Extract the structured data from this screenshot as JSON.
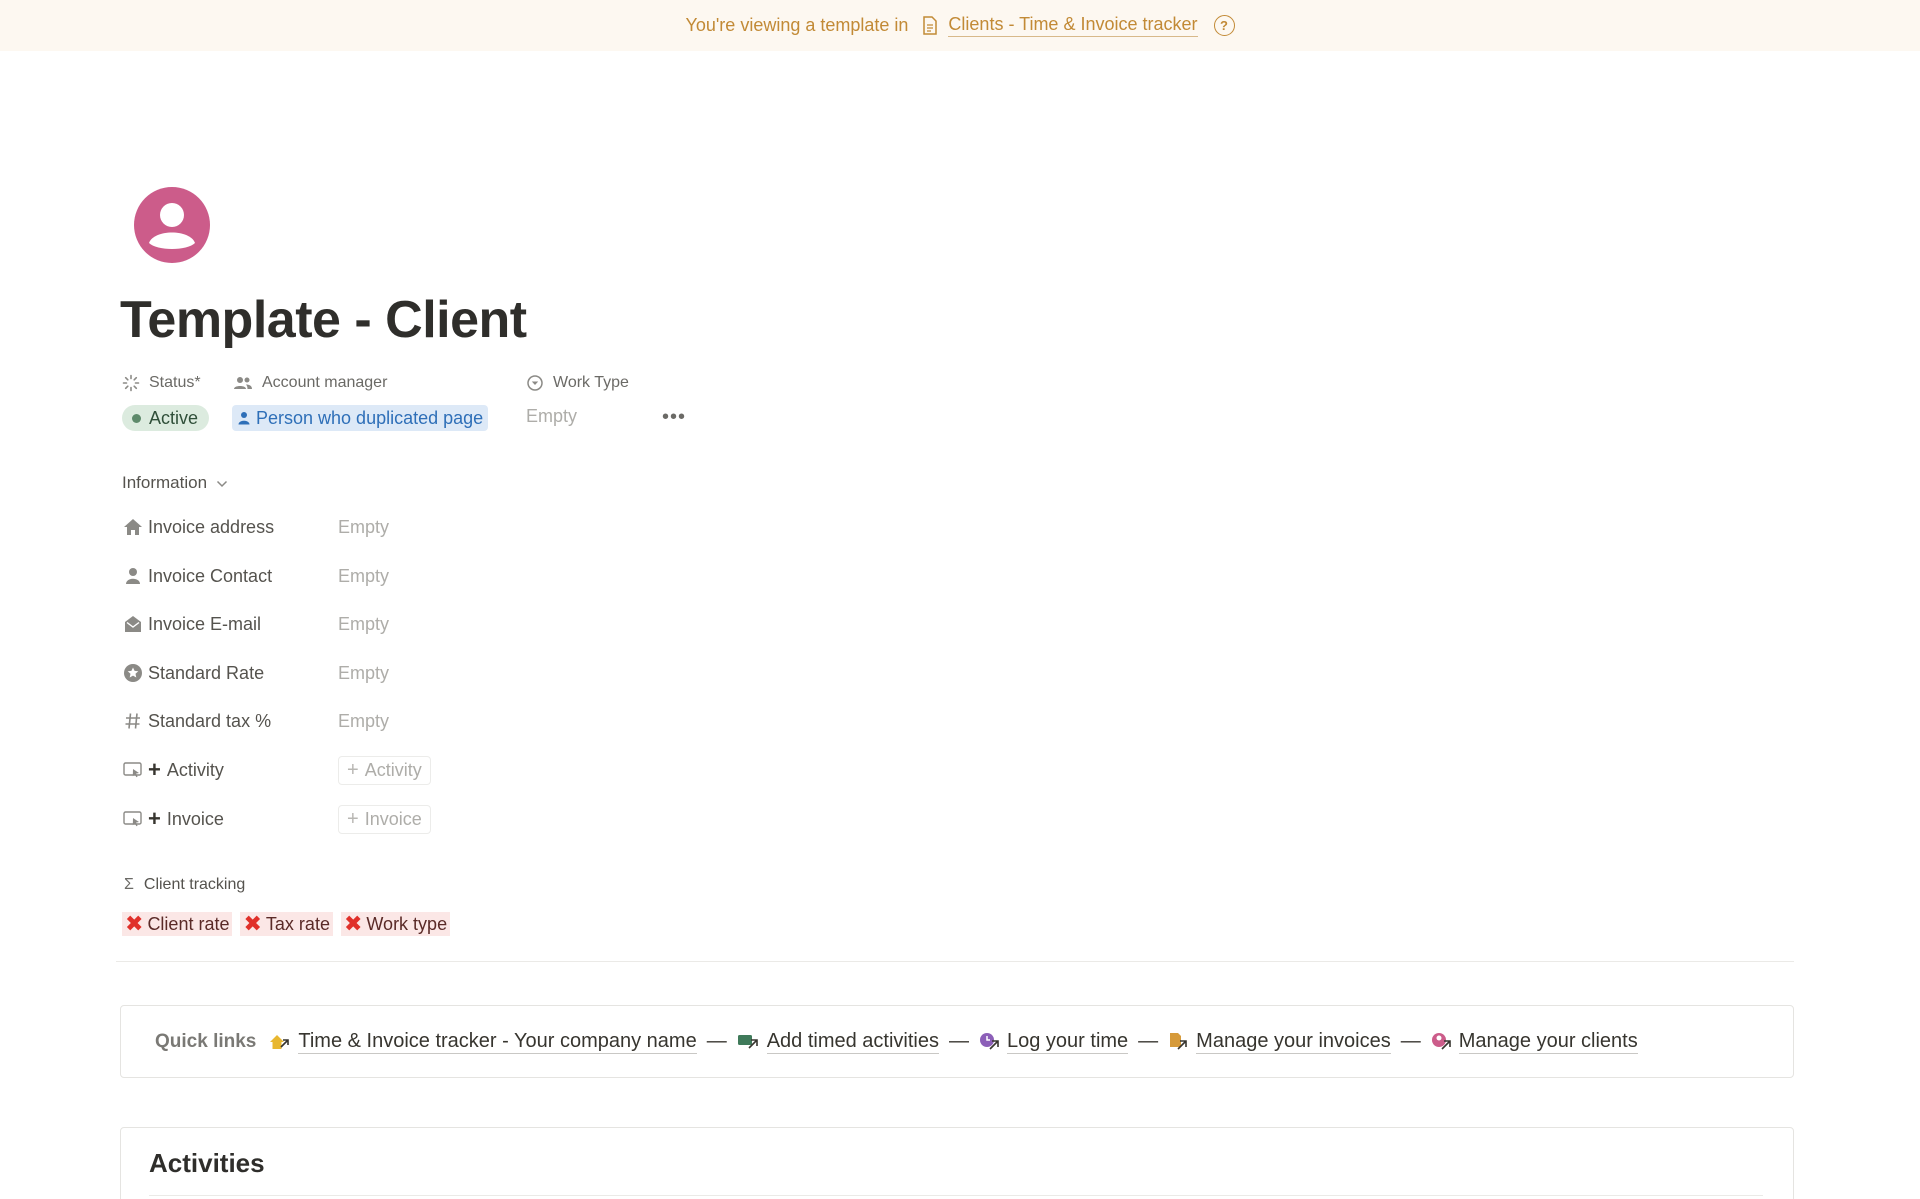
{
  "banner": {
    "prefix": "You're viewing a template in",
    "template_name": "Clients - Time & Invoice tracker",
    "help_glyph": "?",
    "color": "#c28a36"
  },
  "page": {
    "title": "Template - Client",
    "icon": "person-circle-icon",
    "icon_color": "#cc5c8a"
  },
  "properties": {
    "status": {
      "label": "Status*",
      "value": "Active"
    },
    "account_manager": {
      "label": "Account manager",
      "value": "Person who duplicated page"
    },
    "work_type": {
      "label": "Work Type",
      "value": "Empty"
    },
    "more": "•••"
  },
  "information": {
    "label": "Information",
    "rows": [
      {
        "label": "Invoice address",
        "value": "Empty",
        "icon": "home-icon"
      },
      {
        "label": "Invoice Contact",
        "value": "Empty",
        "icon": "person-icon"
      },
      {
        "label": "Invoice E-mail",
        "value": "Empty",
        "icon": "envelope-icon"
      },
      {
        "label": "Standard Rate",
        "value": "Empty",
        "icon": "star-circle-icon"
      },
      {
        "label": "Standard tax %",
        "value": "Empty",
        "icon": "hash-icon"
      }
    ],
    "buttons": [
      {
        "label": "Activity",
        "button": "Activity",
        "icon": "button-icon"
      },
      {
        "label": "Invoice",
        "button": "Invoice",
        "icon": "button-icon"
      }
    ]
  },
  "client_tracking": {
    "label": "Client tracking",
    "items": [
      "Client rate",
      "Tax rate",
      "Work type"
    ]
  },
  "quick_links": {
    "label": "Quick links",
    "links": [
      "Time & Invoice tracker - Your company name",
      "Add timed activities",
      "Log your time",
      "Manage your invoices",
      "Manage your clients"
    ],
    "separator": "—"
  },
  "activities": {
    "title": "Activities"
  }
}
